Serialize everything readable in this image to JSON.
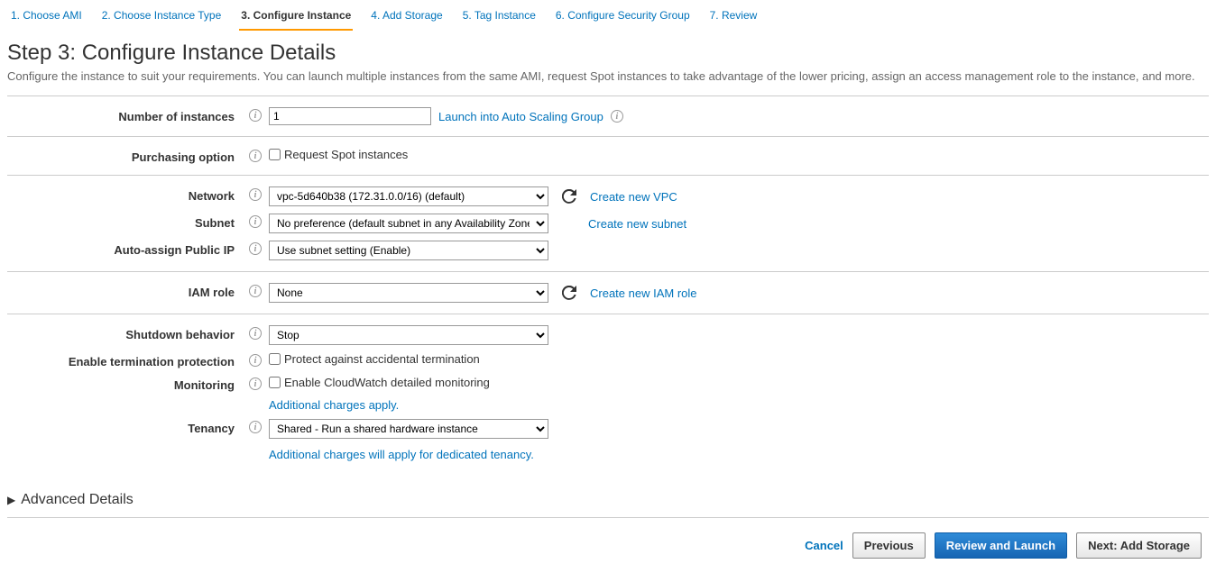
{
  "tabs": {
    "t1": "1. Choose AMI",
    "t2": "2. Choose Instance Type",
    "t3": "3. Configure Instance",
    "t4": "4. Add Storage",
    "t5": "5. Tag Instance",
    "t6": "6. Configure Security Group",
    "t7": "7. Review"
  },
  "heading": "Step 3: Configure Instance Details",
  "description": "Configure the instance to suit your requirements. You can launch multiple instances from the same AMI, request Spot instances to take advantage of the lower pricing, assign an access management role to the instance, and more.",
  "labels": {
    "num_instances": "Number of instances",
    "purchasing": "Purchasing option",
    "network": "Network",
    "subnet": "Subnet",
    "auto_ip": "Auto-assign Public IP",
    "iam": "IAM role",
    "shutdown": "Shutdown behavior",
    "termination": "Enable termination protection",
    "monitoring": "Monitoring",
    "tenancy": "Tenancy"
  },
  "values": {
    "num_instances": "1",
    "network": "vpc-5d640b38 (172.31.0.0/16) (default)",
    "subnet": "No preference (default subnet in any Availability Zone)",
    "auto_ip": "Use subnet setting (Enable)",
    "iam": "None",
    "shutdown": "Stop",
    "tenancy": "Shared - Run a shared hardware instance"
  },
  "links": {
    "asg": "Launch into Auto Scaling Group",
    "new_vpc": "Create new VPC",
    "new_subnet": "Create new subnet",
    "new_iam": "Create new IAM role",
    "charges": "Additional charges apply.",
    "tenancy_charges": "Additional charges will apply for dedicated tenancy."
  },
  "checkboxes": {
    "spot": "Request Spot instances",
    "termination": "Protect against accidental termination",
    "monitoring": "Enable CloudWatch detailed monitoring"
  },
  "advanced": "Advanced Details",
  "footer": {
    "cancel": "Cancel",
    "previous": "Previous",
    "review": "Review and Launch",
    "next": "Next: Add Storage"
  }
}
